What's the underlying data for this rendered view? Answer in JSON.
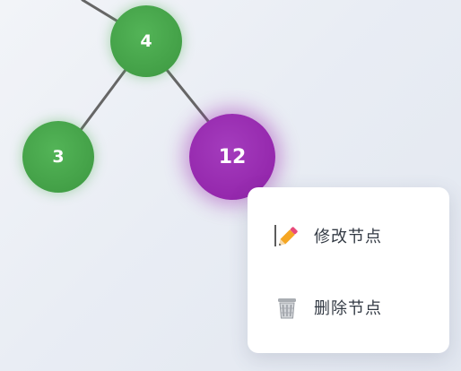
{
  "tree": {
    "nodes": [
      {
        "id": "4",
        "label": "4",
        "state": "normal",
        "color": "#43a047"
      },
      {
        "id": "3",
        "label": "3",
        "state": "normal",
        "color": "#43a047"
      },
      {
        "id": "12",
        "label": "12",
        "state": "selected",
        "color": "#9528ad"
      }
    ],
    "edges": [
      {
        "from": "parent-offscreen",
        "to": "4"
      },
      {
        "from": "4",
        "to": "3"
      },
      {
        "from": "4",
        "to": "12"
      }
    ],
    "edge_color": "#666666"
  },
  "context_menu": {
    "items": [
      {
        "label": "修改节点",
        "icon": "pencil-icon"
      },
      {
        "label": "删除节点",
        "icon": "wastebasket-icon"
      }
    ]
  }
}
